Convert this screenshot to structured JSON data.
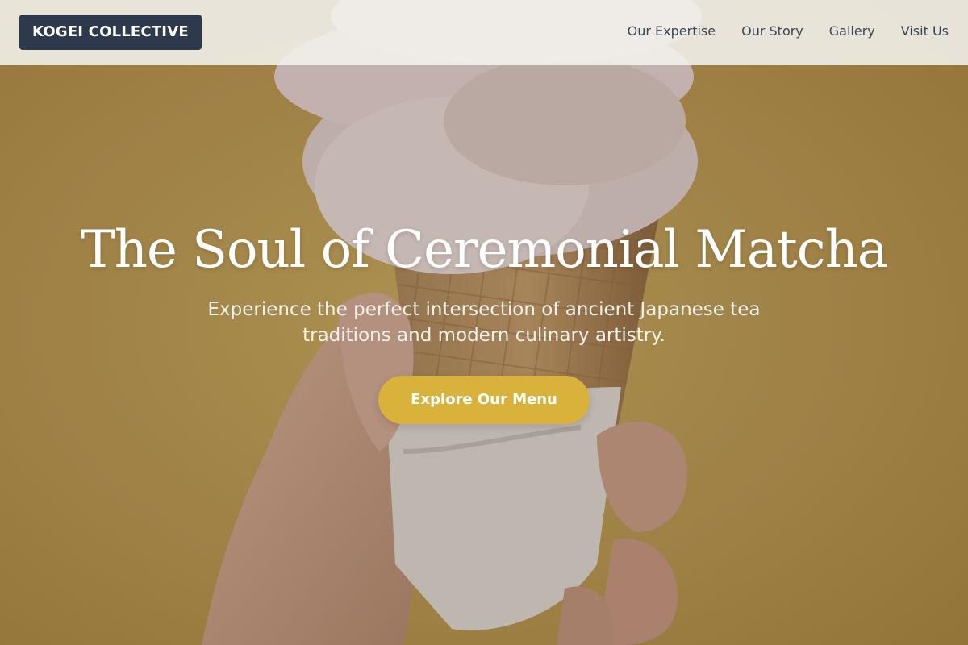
{
  "header": {
    "logo_text": "KOGEI COLLECTIVE",
    "nav": [
      {
        "label": "Our Expertise"
      },
      {
        "label": "Our Story"
      },
      {
        "label": "Gallery"
      },
      {
        "label": "Visit Us"
      }
    ]
  },
  "hero": {
    "title": "The Soul of Ceremonial Matcha",
    "subtitle": "Experience the perfect intersection of ancient Japanese tea traditions and modern culinary artistry.",
    "cta_label": "Explore Our Menu",
    "background_image": "hand-holding-ice-cream-cone-photo"
  },
  "colors": {
    "header_bg": "#f4f2ee",
    "logo_bg": "#2d3a4c",
    "nav_text": "#3b4656",
    "hero_bg": "#a98a4c",
    "cta_bg": "#d8b23a",
    "title_text": "#ffffff"
  }
}
